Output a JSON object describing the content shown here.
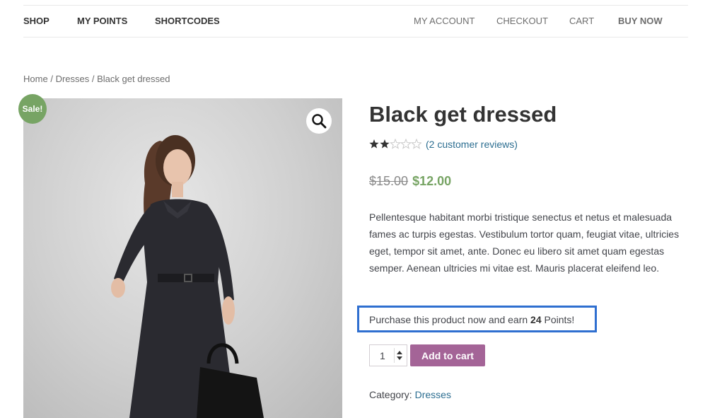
{
  "nav": {
    "left": [
      "SHOP",
      "MY POINTS",
      "SHORTCODES"
    ],
    "right": [
      "MY ACCOUNT",
      "CHECKOUT",
      "CART",
      "BUY NOW"
    ]
  },
  "breadcrumb": {
    "items": [
      "Home",
      "Dresses",
      "Black get dressed"
    ],
    "separator": "/"
  },
  "gallery": {
    "sale_badge": "Sale!",
    "zoom_icon": "magnifier-icon"
  },
  "product": {
    "title": "Black get dressed",
    "rating": 2,
    "rating_max": 5,
    "reviews_link": "(2 customer reviews)",
    "old_price": "$15.00",
    "price": "$12.00",
    "description": "Pellentesque habitant morbi tristique senectus et netus et malesuada fames ac turpis egestas. Vestibulum tortor quam, feugiat vitae, ultricies eget, tempor sit amet, ante. Donec eu libero sit amet quam egestas semper. Aenean ultricies mi vitae est. Mauris placerat eleifend leo.",
    "points": {
      "prefix": "Purchase this product now and earn",
      "amount": "24",
      "suffix": "Points!"
    },
    "quantity": "1",
    "add_to_cart": "Add to cart",
    "category_label": "Category:",
    "category_value": "Dresses"
  },
  "colors": {
    "sale_green": "#77a464",
    "button_purple": "#a46497",
    "link_blue": "#2c6e91",
    "highlight_border": "#2f6fd0"
  }
}
